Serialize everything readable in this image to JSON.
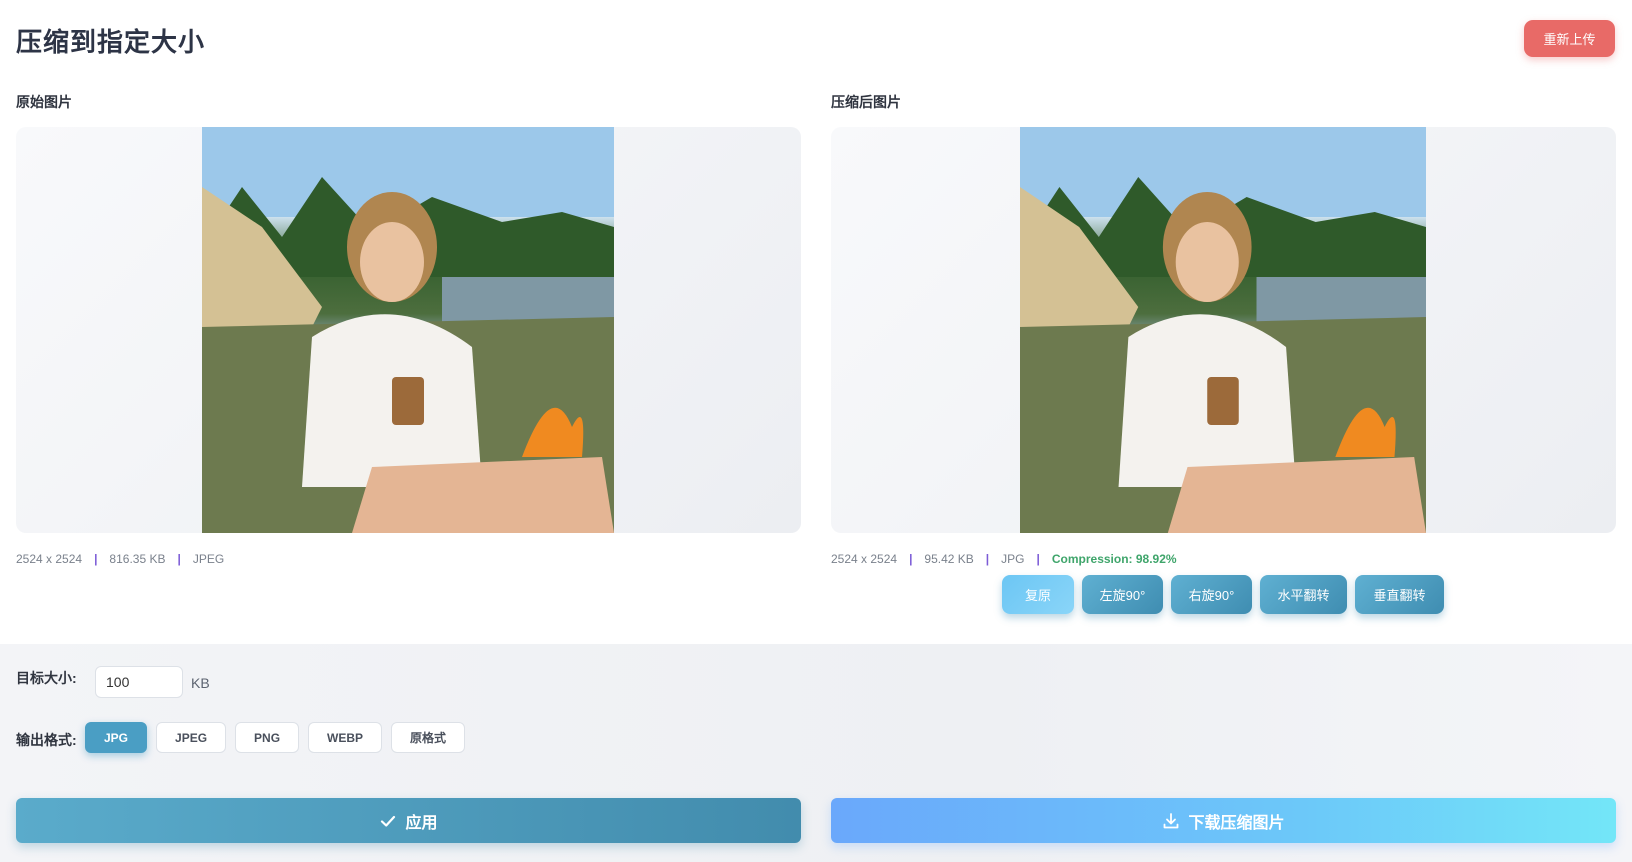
{
  "header": {
    "title": "压缩到指定大小",
    "reupload_label": "重新上传"
  },
  "original": {
    "label": "原始图片",
    "dimensions": "2524 x 2524",
    "size": "816.35 KB",
    "format": "JPEG"
  },
  "compressed": {
    "label": "压缩后图片",
    "dimensions": "2524 x 2524",
    "size": "95.42 KB",
    "format": "JPG",
    "compression": "Compression: 98.92%"
  },
  "transforms": {
    "reset": "复原",
    "rotate_left": "左旋90°",
    "rotate_right": "右旋90°",
    "flip_h": "水平翻转",
    "flip_v": "垂直翻转"
  },
  "settings": {
    "target_size_label": "目标大小:",
    "target_size_value": "100",
    "unit": "KB",
    "format_label": "输出格式:",
    "formats": [
      "JPG",
      "JPEG",
      "PNG",
      "WEBP",
      "原格式"
    ],
    "selected_format": "JPG"
  },
  "actions": {
    "apply": "应用",
    "download": "下载压缩图片"
  },
  "colors": {
    "accent": "#4a9ec4",
    "danger": "#e86a67",
    "success": "#3fa56b",
    "separator": "#7c5cd6"
  }
}
